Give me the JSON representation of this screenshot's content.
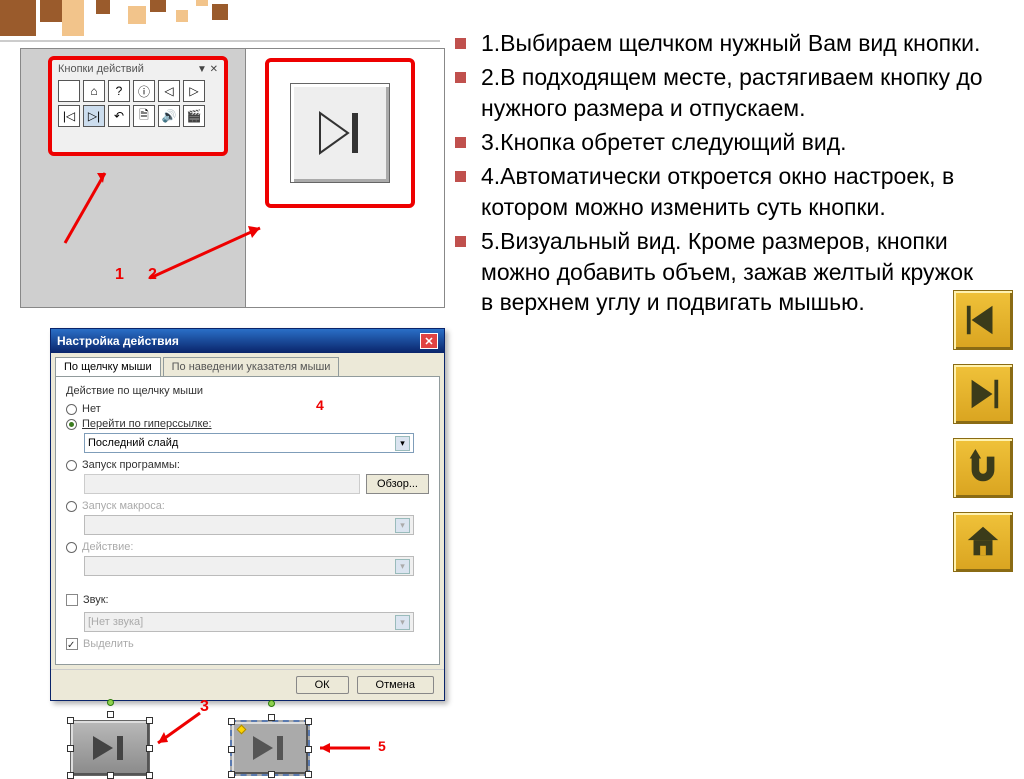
{
  "deco_colors": {
    "dark": "#9a5b2c",
    "light": "#f2c48b"
  },
  "toolbar": {
    "title": "Кнопки действий"
  },
  "num_labels": {
    "n1": "1",
    "n2": "2",
    "n3": "3",
    "n4": "4",
    "n5": "5"
  },
  "dialog": {
    "title": "Настройка действия",
    "tab_click": "По щелчку мыши",
    "tab_hover": "По наведении указателя мыши",
    "group": "Действие по щелчку мыши",
    "opt_none": "Нет",
    "opt_hyper": "Перейти по гиперссылке:",
    "hyper_value": "Последний слайд",
    "opt_run": "Запуск программы:",
    "browse": "Обзор...",
    "opt_macro": "Запуск макроса:",
    "opt_action": "Действие:",
    "sound": "Звук:",
    "sound_value": "[Нет звука]",
    "highlight": "Выделить",
    "ok": "ОК",
    "cancel": "Отмена"
  },
  "steps": [
    "1.Выбираем щелчком нужный Вам вид кнопки.",
    "2.В подходящем месте, растягиваем кнопку до нужного размера и отпускаем.",
    "3.Кнопка обретет следующий вид.",
    "4.Автоматически откроется окно настроек, в котором можно изменить суть кнопки.",
    "5.Визуальный вид. Кроме размеров, кнопки можно добавить объем, зажав желтый кружок в верхнем углу и подвигать мышью."
  ]
}
